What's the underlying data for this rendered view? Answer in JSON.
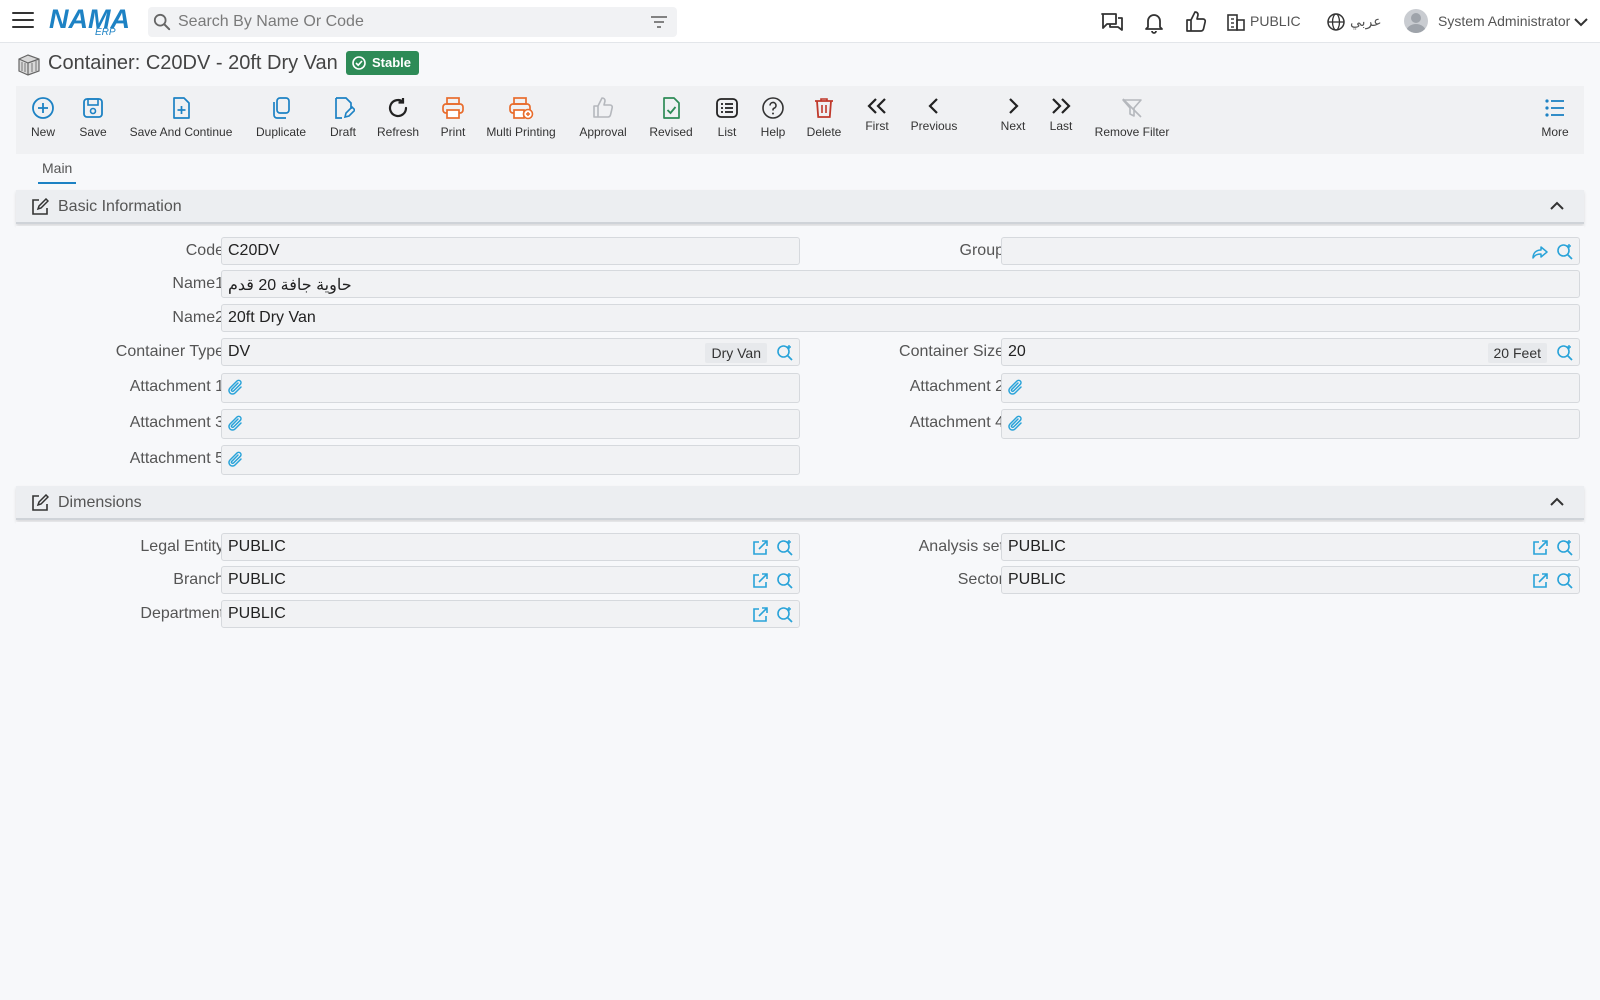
{
  "header": {
    "logo_text": "NAMA",
    "logo_sub": "ERP",
    "search_placeholder": "Search By Name Or Code",
    "company": "PUBLIC",
    "language": "عربي",
    "user": "System Administrator"
  },
  "page": {
    "title": "Container: C20DV - 20ft Dry Van",
    "status": "Stable",
    "status_color": "#2e8b57",
    "accent_color": "#1d82c4"
  },
  "toolbar": {
    "new": "New",
    "save": "Save",
    "save_continue": "Save And Continue",
    "duplicate": "Duplicate",
    "draft": "Draft",
    "refresh": "Refresh",
    "print": "Print",
    "multi_printing": "Multi Printing",
    "approval": "Approval",
    "revised": "Revised",
    "list": "List",
    "help": "Help",
    "delete": "Delete",
    "first": "First",
    "previous": "Previous",
    "next": "Next",
    "last": "Last",
    "remove_filter": "Remove Filter",
    "more": "More"
  },
  "tabs": {
    "main": "Main"
  },
  "basic": {
    "title": "Basic Information",
    "code_label": "Code",
    "code_value": "C20DV",
    "group_label": "Group",
    "group_value": "",
    "name1_label": "Name1",
    "name1_value": "حاوية جافة 20 قدم",
    "name2_label": "Name2",
    "name2_value": "20ft Dry Van",
    "container_type_label": "Container Type",
    "container_type_value": "DV",
    "container_type_desc": "Dry Van",
    "container_size_label": "Container Size",
    "container_size_value": "20",
    "container_size_desc": "20 Feet",
    "attachment1_label": "Attachment 1",
    "attachment2_label": "Attachment 2",
    "attachment3_label": "Attachment 3",
    "attachment4_label": "Attachment 4",
    "attachment5_label": "Attachment 5"
  },
  "dimensions": {
    "title": "Dimensions",
    "legal_entity_label": "Legal Entity",
    "legal_entity_value": "PUBLIC",
    "analysis_set_label": "Analysis set",
    "analysis_set_value": "PUBLIC",
    "branch_label": "Branch",
    "branch_value": "PUBLIC",
    "sector_label": "Sector",
    "sector_value": "PUBLIC",
    "department_label": "Department",
    "department_value": "PUBLIC"
  }
}
